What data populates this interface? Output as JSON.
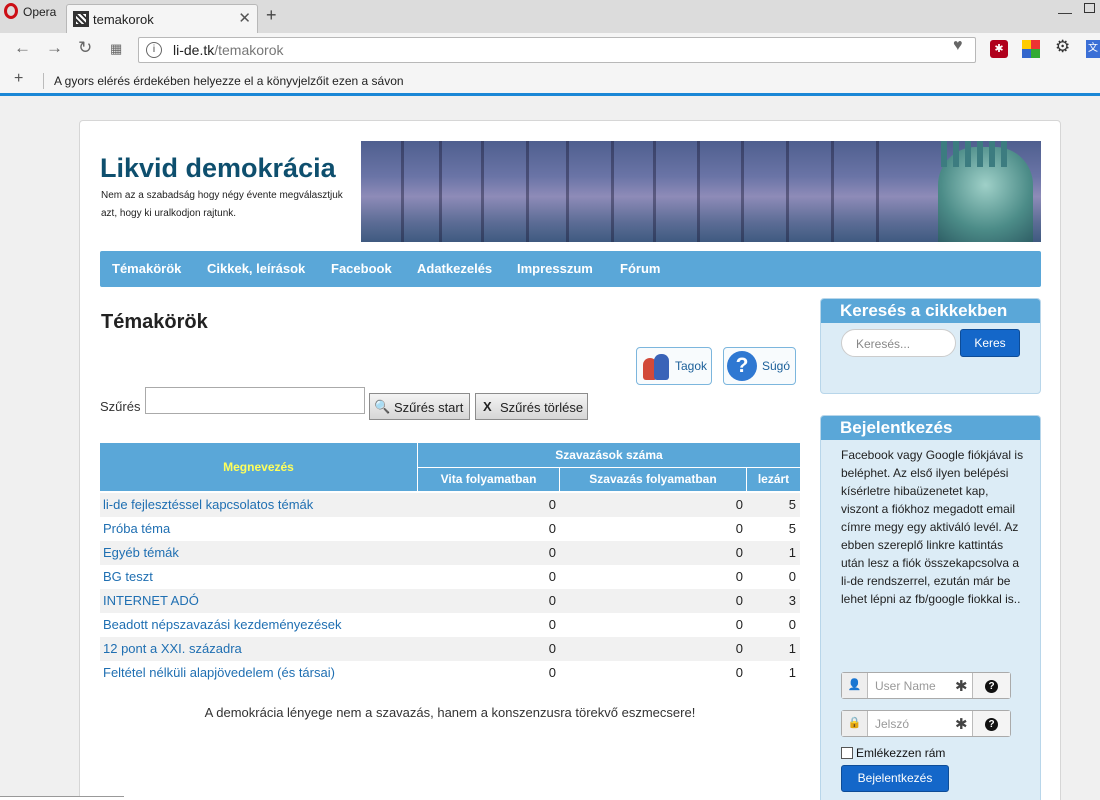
{
  "browser": {
    "opera_label": "Opera",
    "tab_title": "temakorok",
    "url_host": "li-de.tk",
    "url_path": "/temakorok",
    "bookmarks_hint": "A gyors elérés érdekében helyezze el a könyvjelzőit ezen a sávon"
  },
  "site": {
    "title": "Likvid demokrácia",
    "subtitle": "Nem az a szabadság hogy négy évente megválasztjuk azt, hogy ki uralkodjon rajtunk."
  },
  "menu": [
    {
      "label": "Témakörök"
    },
    {
      "label": "Cikkek, leírások"
    },
    {
      "label": "Facebook"
    },
    {
      "label": "Adatkezelés"
    },
    {
      "label": "Impresszum"
    },
    {
      "label": "Fórum"
    }
  ],
  "main": {
    "title": "Témakörök",
    "members_label": "Tagok",
    "help_label": "Súgó",
    "filter_label": "Szűrés",
    "filter_value": "",
    "filter_start": "Szűrés start",
    "filter_clear": "Szűrés törlése",
    "footer_quote": "A demokrácia lényege nem a szavazás, hanem a konszenzusra törekvő eszmecsere!"
  },
  "table": {
    "col_name": "Megnevezés",
    "col_group": "Szavazások száma",
    "col_debate": "Vita folyamatban",
    "col_voting": "Szavazás folyamatban",
    "col_closed": "lezárt",
    "rows": [
      {
        "name": "li-de fejlesztéssel kapcsolatos témák",
        "debate": "0",
        "voting": "0",
        "closed": "5"
      },
      {
        "name": "Próba téma",
        "debate": "0",
        "voting": "0",
        "closed": "5"
      },
      {
        "name": "Egyéb témák",
        "debate": "0",
        "voting": "0",
        "closed": "1"
      },
      {
        "name": "BG teszt",
        "debate": "0",
        "voting": "0",
        "closed": "0"
      },
      {
        "name": "INTERNET ADÓ",
        "debate": "0",
        "voting": "0",
        "closed": "3"
      },
      {
        "name": "Beadott népszavazási kezdeményezések",
        "debate": "0",
        "voting": "0",
        "closed": "0"
      },
      {
        "name": "12 pont a XXI. századra",
        "debate": "0",
        "voting": "0",
        "closed": "1"
      },
      {
        "name": "Feltétel nélküli alapjövedelem (és társai)",
        "debate": "0",
        "voting": "0",
        "closed": "1"
      }
    ]
  },
  "sidebar": {
    "search_title": "Keresés a cikkekben",
    "search_placeholder": "Keresés...",
    "search_button": "Keres",
    "login_title": "Bejelentkezés",
    "login_text": "Facebook vagy Google fiókjával is beléphet. Az első ilyen belépési kísérletre hibaüzenetet kap, viszont a fiókhoz megadott email címre megy egy aktiváló levél. Az ebben szereplő linkre kattintás után lesz a fiók összekapcsolva a li-de rendszerrel, ezután már be lehet lépni az fb/google fiokkal is..",
    "username_placeholder": "User Name",
    "password_placeholder": "Jelszó",
    "remember_label": "Emlékezzen rám",
    "login_button": "Bejelentkezés"
  },
  "colors": {
    "accent": "#5aa7d8",
    "link": "#1f6fb2",
    "button": "#1467c9",
    "title": "#0e4f6e"
  }
}
